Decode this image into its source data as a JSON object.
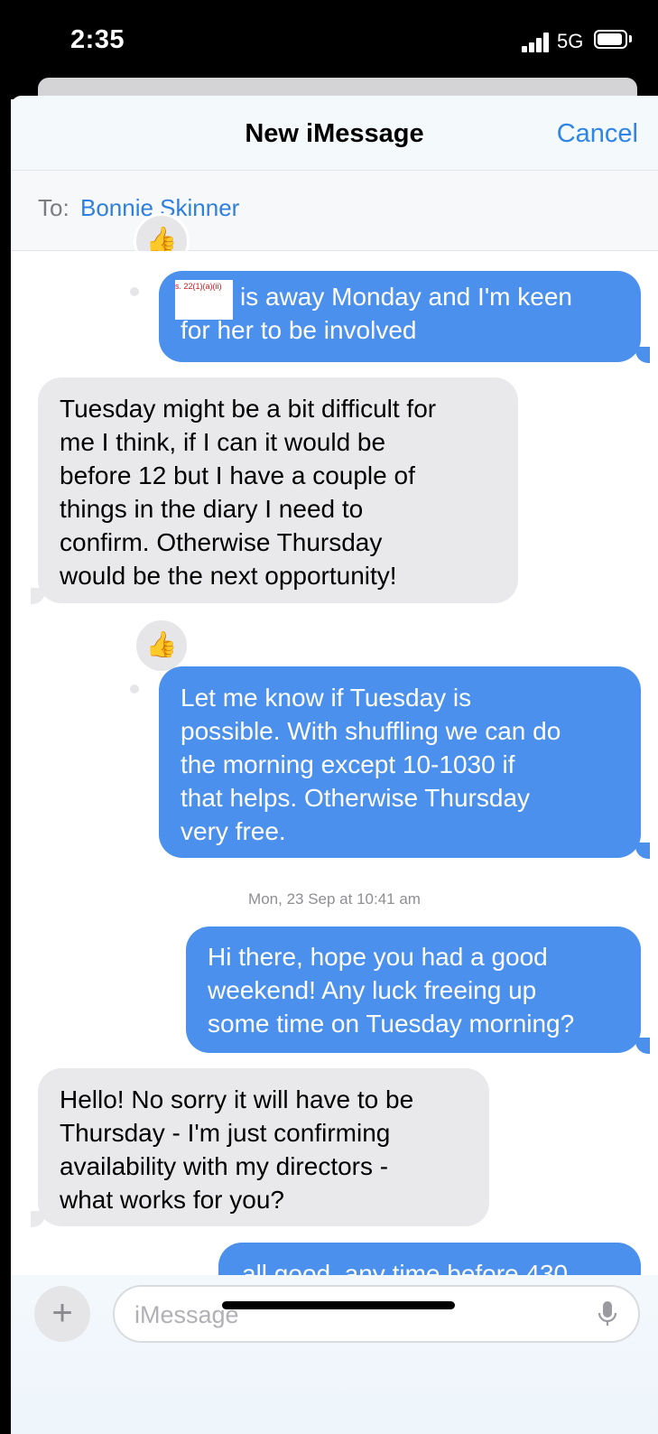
{
  "status": {
    "time": "2:35",
    "network": "5G"
  },
  "header": {
    "title": "New iMessage",
    "cancel_label": "Cancel"
  },
  "to": {
    "label": "To:",
    "name": "Bonnie Skinner"
  },
  "redaction": {
    "note": "s. 22(1)(a)(ii)"
  },
  "messages": [
    {
      "side": "sent",
      "lines": [
        "is away Monday and I'm keen",
        "for her to be involved"
      ]
    },
    {
      "side": "received",
      "lines": [
        "Tuesday might be a bit difficult for",
        "me I think, if I can it would be",
        "before 12 but I have a couple of",
        "things in the diary I need to",
        "confirm. Otherwise Thursday",
        "would be the next opportunity!"
      ]
    },
    {
      "side": "sent",
      "lines": [
        "Let me know if Tuesday is",
        "possible. With shuffling we can do",
        "the morning except 10-1030 if",
        "that helps. Otherwise Thursday",
        "very free."
      ]
    },
    {
      "side": "sent",
      "lines": [
        "Hi there, hope you had a good",
        "weekend! Any luck freeing up",
        "some time on Tuesday morning?"
      ]
    },
    {
      "side": "received",
      "lines": [
        "Hello! No sorry it will have to be",
        "Thursday - I'm just confirming",
        "availability with my directors -",
        "what works for you?"
      ]
    },
    {
      "side": "sent",
      "lines": [
        "all good, any time before 430"
      ]
    }
  ],
  "timestamp": "Mon, 23 Sep at 10:41 am",
  "tapback_icon": "thumbs-up-icon",
  "composer": {
    "placeholder": "iMessage"
  },
  "colors": {
    "sent_bubble": "#4a90ec",
    "received_bubble": "#e9e9eb",
    "accent": "#2f84e8"
  }
}
